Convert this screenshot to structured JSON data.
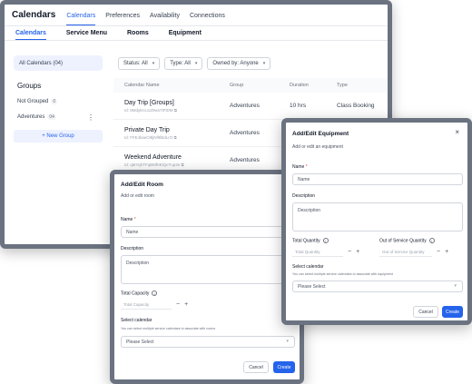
{
  "app": {
    "title": "Calendars",
    "top_nav": [
      "Calendars",
      "Preferences",
      "Availability",
      "Connections"
    ],
    "sub_tabs": [
      "Calendars",
      "Service Menu",
      "Rooms",
      "Equipment"
    ]
  },
  "sidebar": {
    "all_calendars": "All Calendars (04)",
    "groups_heading": "Groups",
    "groups": [
      {
        "name": "Not Grouped",
        "count": "0"
      },
      {
        "name": "Adventures",
        "count": "04"
      }
    ],
    "new_group": "+ New Group"
  },
  "filters": {
    "status": "Status: All",
    "type": "Type: All",
    "owned_by": "Owned by: Anyone"
  },
  "table": {
    "headers": [
      "Calendar Name",
      "Group",
      "Duration",
      "Type"
    ],
    "rows": [
      {
        "name": "Day Trip [Groups]",
        "id": "Id: 8Mdykrcu1Z9ws7tFlDM",
        "group": "Adventures",
        "duration": "10 hrs",
        "type": "Class Booking"
      },
      {
        "name": "Private Day Trip",
        "id": "Id: FFEJkaeOl8jNf9lBdLrO",
        "group": "Adventures",
        "duration": "",
        "type": ""
      },
      {
        "name": "Weekend Adventure",
        "id": "Id: q6tYqhTFqBMf0ElQeTup3e",
        "group": "Adventures",
        "duration": "",
        "type": ""
      }
    ]
  },
  "room_modal": {
    "title": "Add/Edit Room",
    "subtitle": "Add or edit room",
    "name_label": "Name",
    "name_placeholder": "Name",
    "description_label": "Description",
    "description_placeholder": "Description",
    "capacity_label": "Total Capacity",
    "capacity_placeholder": "Total Capacity",
    "calendar_label": "Select calendar",
    "calendar_hint": "You can select multiple service calendars to associate with rooms",
    "calendar_placeholder": "Please Select",
    "cancel": "Cancel",
    "create": "Create"
  },
  "equipment_modal": {
    "title": "Add/Edit Equipment",
    "subtitle": "Add or edit an equipment",
    "name_label": "Name",
    "name_placeholder": "Name",
    "description_label": "Description",
    "description_placeholder": "Description",
    "quantity_label": "Total Quantity",
    "quantity_placeholder": "Total Quantity",
    "oos_label": "Out of Service Quantity",
    "oos_placeholder": "Out of Service Quantity",
    "calendar_label": "Select calendar",
    "calendar_hint": "You can select multiple service calendars to associate with equipment",
    "calendar_placeholder": "Please Select",
    "cancel": "Cancel",
    "create": "Create"
  },
  "colors": {
    "accent": "#2563eb",
    "frame": "#6b7280",
    "required": "#ef4444"
  }
}
